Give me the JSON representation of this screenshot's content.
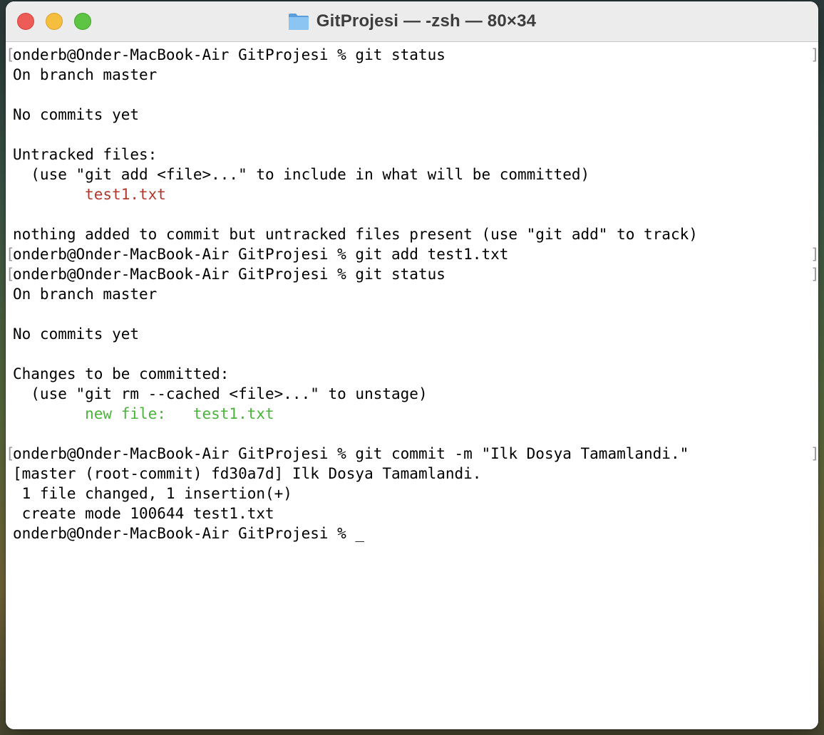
{
  "window": {
    "title": "GitProjesi — -zsh — 80×34",
    "title_icon": "folder-icon"
  },
  "terminal": {
    "prompt": "onderb@Onder-MacBook-Air GitProjesi %",
    "mark_left": "[",
    "mark_right": "]",
    "lines": [
      {
        "type": "prompt",
        "text": "onderb@Onder-MacBook-Air GitProjesi % git status"
      },
      {
        "type": "output",
        "text": "On branch master"
      },
      {
        "type": "blank",
        "text": ""
      },
      {
        "type": "output",
        "text": "No commits yet"
      },
      {
        "type": "blank",
        "text": ""
      },
      {
        "type": "output",
        "text": "Untracked files:"
      },
      {
        "type": "output",
        "text": "  (use \"git add <file>...\" to include in what will be committed)"
      },
      {
        "type": "untracked",
        "text": "        test1.txt"
      },
      {
        "type": "blank",
        "text": ""
      },
      {
        "type": "output",
        "text": "nothing added to commit but untracked files present (use \"git add\" to track)"
      },
      {
        "type": "prompt",
        "text": "onderb@Onder-MacBook-Air GitProjesi % git add test1.txt"
      },
      {
        "type": "prompt",
        "text": "onderb@Onder-MacBook-Air GitProjesi % git status"
      },
      {
        "type": "output",
        "text": "On branch master"
      },
      {
        "type": "blank",
        "text": ""
      },
      {
        "type": "output",
        "text": "No commits yet"
      },
      {
        "type": "blank",
        "text": ""
      },
      {
        "type": "output",
        "text": "Changes to be committed:"
      },
      {
        "type": "output",
        "text": "  (use \"git rm --cached <file>...\" to unstage)"
      },
      {
        "type": "staged",
        "text": "        new file:   test1.txt"
      },
      {
        "type": "blank",
        "text": ""
      },
      {
        "type": "prompt",
        "text": "onderb@Onder-MacBook-Air GitProjesi % git commit -m \"Ilk Dosya Tamamlandi.\""
      },
      {
        "type": "output",
        "text": "[master (root-commit) fd30a7d] Ilk Dosya Tamamlandi."
      },
      {
        "type": "output",
        "text": " 1 file changed, 1 insertion(+)"
      },
      {
        "type": "output",
        "text": " create mode 100644 test1.txt"
      },
      {
        "type": "current",
        "text": "onderb@Onder-MacBook-Air GitProjesi % _"
      }
    ]
  },
  "colors": {
    "untracked": "#b0392b",
    "staged": "#4bb33c",
    "close_button": "#ee5c57",
    "minimize_button": "#f5be3f",
    "zoom_button": "#5ec443"
  }
}
